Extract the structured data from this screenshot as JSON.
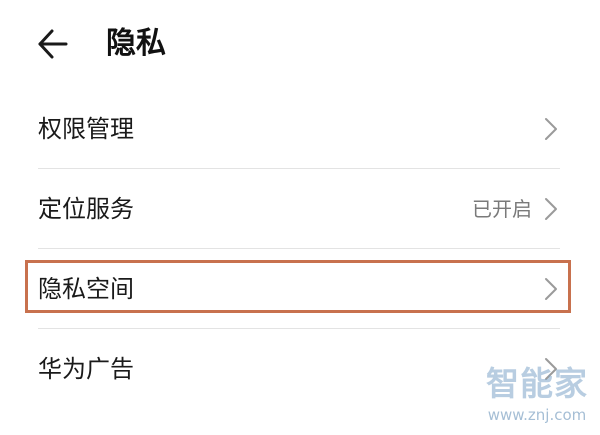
{
  "header": {
    "back_icon": "arrow-left-icon",
    "title": "隐私"
  },
  "rows": [
    {
      "label": "权限管理",
      "value": "",
      "icon": "chevron-right-icon"
    },
    {
      "label": "定位服务",
      "value": "已开启",
      "icon": "chevron-right-icon"
    },
    {
      "label": "隐私空间",
      "value": "",
      "icon": "chevron-right-icon",
      "highlighted": true
    },
    {
      "label": "华为广告",
      "value": "",
      "icon": "chevron-right-icon"
    }
  ],
  "highlight_color": "#c8714e",
  "watermark": {
    "title": "智能家",
    "url": "www.znj.com"
  }
}
